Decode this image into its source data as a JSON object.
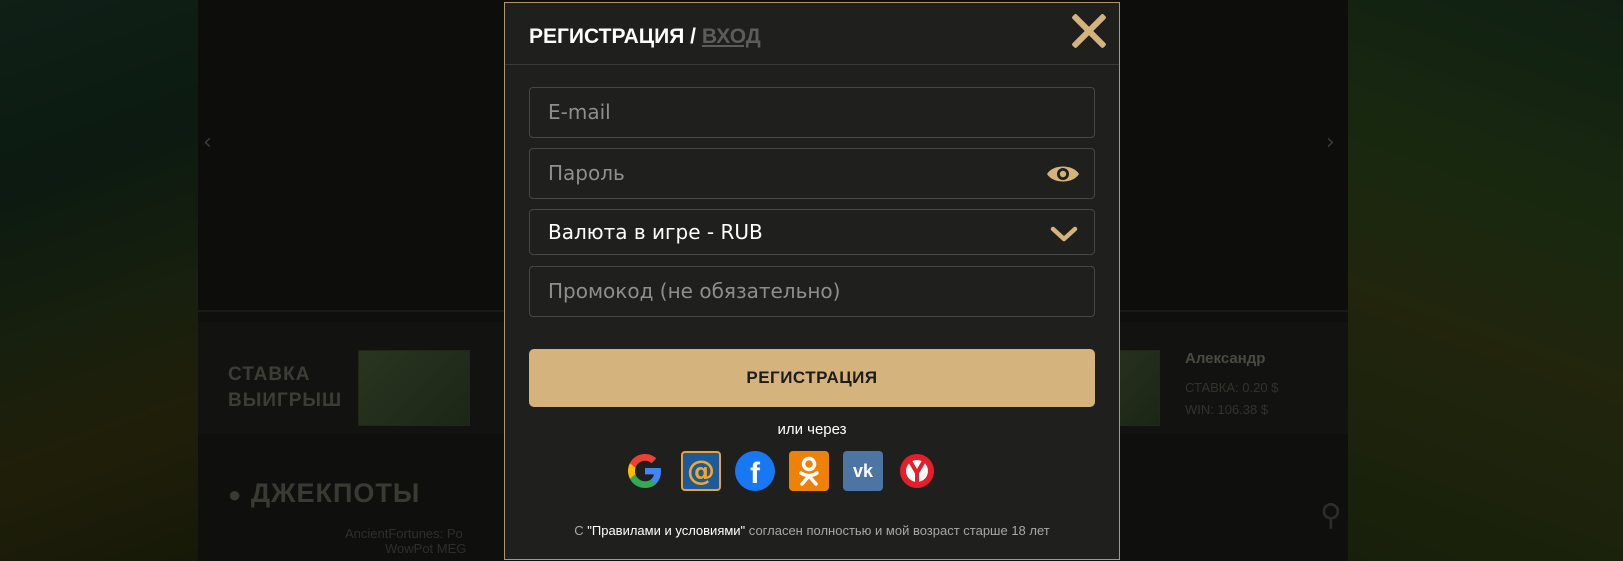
{
  "modal": {
    "title_register": "РЕГИСТРАЦИЯ /",
    "title_login": "ВХОД",
    "email_placeholder": "E-mail",
    "password_placeholder": "Пароль",
    "currency_value": "Валюта в игре - RUB",
    "promo_placeholder": "Промокод (не обязательно)",
    "register_button": "РЕГИСТРАЦИЯ",
    "or_via": "или через",
    "socials": [
      "google-icon",
      "mailru-icon",
      "facebook-icon",
      "odnoklassniki-icon",
      "vk-icon",
      "yandex-icon"
    ],
    "terms_prefix": "С ",
    "terms_link": "\"Правилами и условиями\"",
    "terms_suffix": " согласен полностью и мой возраст старше 18 лет",
    "accent_color": "#d4b47c"
  },
  "background": {
    "bet_label": "СТАВКА",
    "win_label": "ВЫИГРЫШ",
    "winner_name": "Александр",
    "winner_bet": "СТАВКА: 0.20 $",
    "winner_win": "WIN: 106.38 $",
    "jackpots_title": "ДЖЕКПОТЫ",
    "jackpot_item_line1": "AncientFortunes: Po",
    "jackpot_item_line2": "WowPot MEG"
  }
}
